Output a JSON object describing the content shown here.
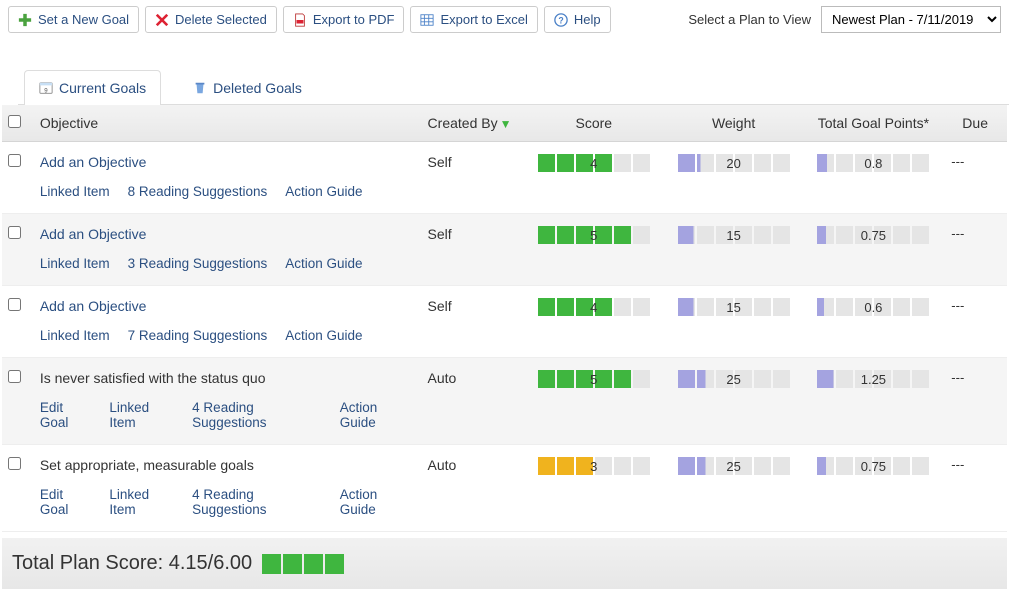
{
  "toolbar": {
    "set_goal": "Set a New Goal",
    "delete_selected": "Delete Selected",
    "export_pdf": "Export to PDF",
    "export_excel": "Export to Excel",
    "help": "Help",
    "plan_label": "Select a Plan to View",
    "plan_selected": "Newest Plan - 7/11/2019"
  },
  "tabs": {
    "current": "Current Goals",
    "deleted": "Deleted Goals"
  },
  "headers": {
    "objective": "Objective",
    "created_by": "Created By",
    "score": "Score",
    "weight": "Weight",
    "total_points": "Total Goal Points*",
    "due": "Due"
  },
  "rows": [
    {
      "objective": "Add an Objective",
      "objective_is_link": true,
      "links": [
        "Linked Item",
        "8 Reading Suggestions",
        "Action Guide"
      ],
      "created_by": "Self",
      "score": {
        "value": "4",
        "filled": 4,
        "color": "green"
      },
      "weight": {
        "value": "20",
        "fill_pct": 20
      },
      "points": {
        "value": "0.8",
        "fill_pct": 10
      },
      "due": "---"
    },
    {
      "objective": "Add an Objective",
      "objective_is_link": true,
      "links": [
        "Linked Item",
        "3 Reading Suggestions",
        "Action Guide"
      ],
      "created_by": "Self",
      "score": {
        "value": "5",
        "filled": 5,
        "color": "green"
      },
      "weight": {
        "value": "15",
        "fill_pct": 15
      },
      "points": {
        "value": "0.75",
        "fill_pct": 9
      },
      "due": "---"
    },
    {
      "objective": "Add an Objective",
      "objective_is_link": true,
      "links": [
        "Linked Item",
        "7 Reading Suggestions",
        "Action Guide"
      ],
      "created_by": "Self",
      "score": {
        "value": "4",
        "filled": 4,
        "color": "green"
      },
      "weight": {
        "value": "15",
        "fill_pct": 15
      },
      "points": {
        "value": "0.6",
        "fill_pct": 7
      },
      "due": "---"
    },
    {
      "objective": "Is never satisfied with the status quo",
      "objective_is_link": false,
      "links": [
        "Edit Goal",
        "Linked Item",
        "4 Reading Suggestions",
        "Action Guide"
      ],
      "created_by": "Auto",
      "score": {
        "value": "5",
        "filled": 5,
        "color": "green"
      },
      "weight": {
        "value": "25",
        "fill_pct": 25
      },
      "points": {
        "value": "1.25",
        "fill_pct": 16
      },
      "due": "---"
    },
    {
      "objective": "Set appropriate, measurable goals",
      "objective_is_link": false,
      "links": [
        "Edit Goal",
        "Linked Item",
        "4 Reading Suggestions",
        "Action Guide"
      ],
      "created_by": "Auto",
      "score": {
        "value": "3",
        "filled": 3,
        "color": "orange"
      },
      "weight": {
        "value": "25",
        "fill_pct": 25
      },
      "points": {
        "value": "0.75",
        "fill_pct": 9
      },
      "due": "---"
    }
  ],
  "footer": {
    "label": "Total Plan Score: 4.15/6.00",
    "filled": 4
  }
}
